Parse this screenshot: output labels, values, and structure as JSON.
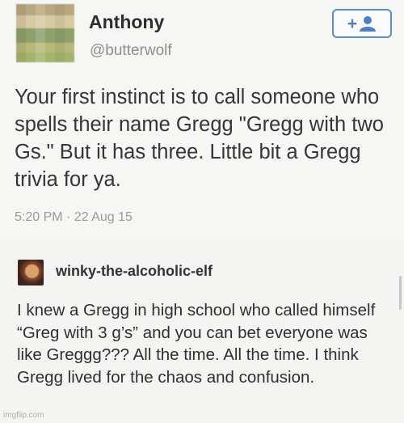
{
  "tweet": {
    "user_name": "Anthony",
    "handle": "@butterwolf",
    "follow_button_icon": "add-user-icon",
    "text": "Your first instinct is to call someone who spells their name Gregg \"Gregg with two Gs.\" But it has three. Little bit a Gregg trivia for ya.",
    "timestamp": "5:20 PM · 22 Aug 15"
  },
  "reblog": {
    "username": "winky-the-alcoholic-elf",
    "text": "I knew a Gregg in high school who called himself “Greg with 3 g’s” and you can bet everyone was like Greggg??? All the time. All the time. I think Gregg lived for the chaos and confusion."
  },
  "watermark": "imgflip.com",
  "colors": {
    "accent": "#4a7fc8",
    "muted_text": "#8e8e8e"
  }
}
